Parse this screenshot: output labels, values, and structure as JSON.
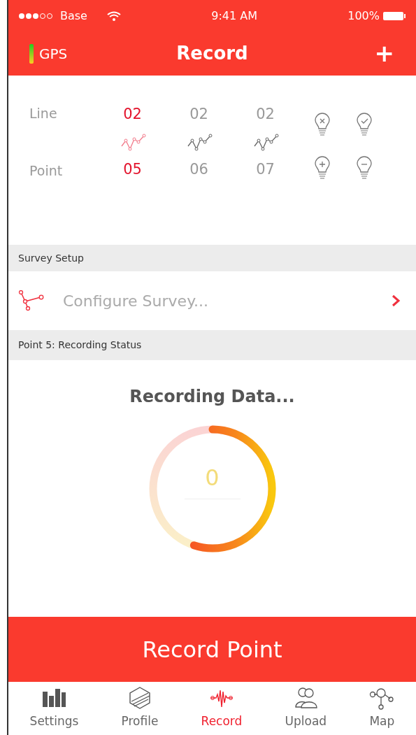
{
  "status_bar": {
    "carrier": "Base",
    "time": "9:41 AM",
    "battery": "100%"
  },
  "nav": {
    "gps_label": "GPS",
    "title": "Record",
    "add": "+"
  },
  "selector": {
    "line_label": "Line",
    "point_label": "Point",
    "columns": [
      {
        "line": "02",
        "point": "05",
        "selected": true
      },
      {
        "line": "02",
        "point": "06",
        "selected": false
      },
      {
        "line": "02",
        "point": "07",
        "selected": false
      }
    ]
  },
  "survey_setup": {
    "header": "Survey Setup",
    "item": "Configure Survey..."
  },
  "recording": {
    "header": "Point 5: Recording Status",
    "title": "Recording Data...",
    "level": 0.55,
    "reading": "0"
  },
  "record_button": "Record Point",
  "tabs": [
    {
      "label": "Settings",
      "selected": false
    },
    {
      "label": "Profile",
      "selected": false
    },
    {
      "label": "Record",
      "selected": true
    },
    {
      "label": "Upload",
      "selected": false
    },
    {
      "label": "Map",
      "selected": false
    }
  ]
}
